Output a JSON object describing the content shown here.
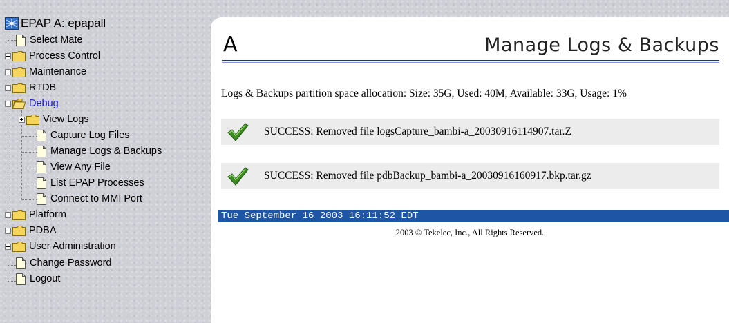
{
  "tree": {
    "root_label": "EPAP A: epapall",
    "items": [
      {
        "label": "Select Mate",
        "type": "page"
      },
      {
        "label": "Process Control",
        "type": "folder",
        "state": "collapsed"
      },
      {
        "label": "Maintenance",
        "type": "folder",
        "state": "collapsed"
      },
      {
        "label": "RTDB",
        "type": "folder",
        "state": "collapsed"
      },
      {
        "label": "Debug",
        "type": "folder",
        "state": "expanded",
        "active": true
      },
      {
        "label": "View Logs",
        "type": "folder",
        "state": "collapsed",
        "level": 2
      },
      {
        "label": "Capture Log Files",
        "type": "page",
        "level": 2
      },
      {
        "label": "Manage Logs & Backups",
        "type": "page",
        "level": 2
      },
      {
        "label": "View Any File",
        "type": "page",
        "level": 2
      },
      {
        "label": "List EPAP Processes",
        "type": "page",
        "level": 2
      },
      {
        "label": "Connect to MMI Port",
        "type": "page",
        "level": 2
      },
      {
        "label": "Platform",
        "type": "folder",
        "state": "collapsed"
      },
      {
        "label": "PDBA",
        "type": "folder",
        "state": "collapsed"
      },
      {
        "label": "User Administration",
        "type": "folder",
        "state": "collapsed"
      },
      {
        "label": "Change Password",
        "type": "page"
      },
      {
        "label": "Logout",
        "type": "page"
      }
    ]
  },
  "main": {
    "mate_letter": "A",
    "title": "Manage Logs & Backups",
    "allocation_text": "Logs & Backups partition space allocation: Size: 35G, Used: 40M, Available: 33G, Usage: 1%",
    "messages": [
      {
        "icon": "check-icon",
        "text": "SUCCESS: Removed file logsCapture_bambi-a_20030916114907.tar.Z"
      },
      {
        "icon": "check-icon",
        "text": "SUCCESS: Removed file pdbBackup_bambi-a_20030916160917.bkp.tar.gz"
      }
    ],
    "datetime": "Tue September 16 2003 16:11:52 EDT",
    "footer": "2003 © Tekelec, Inc., All Rights Reserved."
  },
  "colors": {
    "active_link": "#1b1bd6",
    "date_bar": "#1f55a5",
    "title_rule": "#1c2f8f",
    "success_check": "#3a8a1e"
  }
}
